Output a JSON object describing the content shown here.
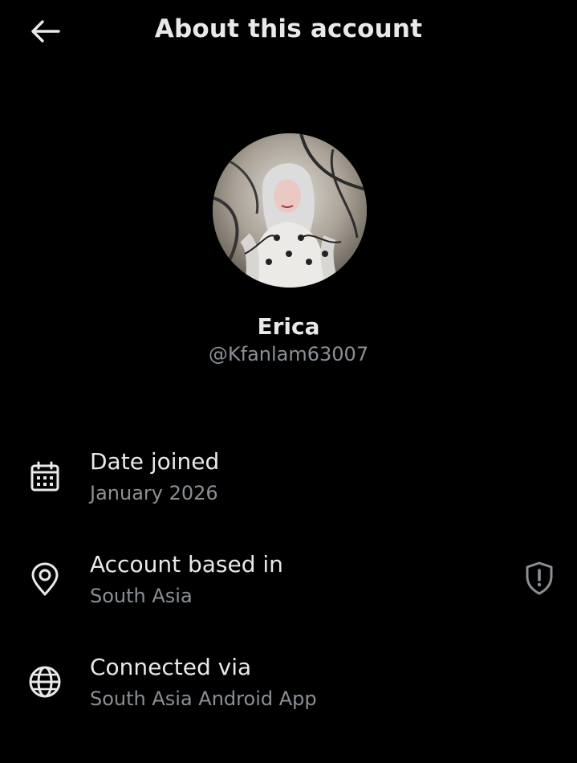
{
  "header": {
    "title": "About this account",
    "back_icon": "arrow-left-icon"
  },
  "profile": {
    "display_name": "Erica",
    "handle": "@Kfanlam63007"
  },
  "info": {
    "date_joined": {
      "label": "Date joined",
      "value": "January 2026",
      "icon": "calendar-icon"
    },
    "account_based_in": {
      "label": "Account based in",
      "value": "South Asia",
      "icon": "location-pin-icon",
      "trailing_icon": "shield-alert-icon"
    },
    "connected_via": {
      "label": "Connected via",
      "value": "South Asia Android App",
      "icon": "globe-icon"
    }
  },
  "colors": {
    "background": "#000000",
    "primary_text": "#e7e9ea",
    "secondary_text": "#8b9096"
  }
}
